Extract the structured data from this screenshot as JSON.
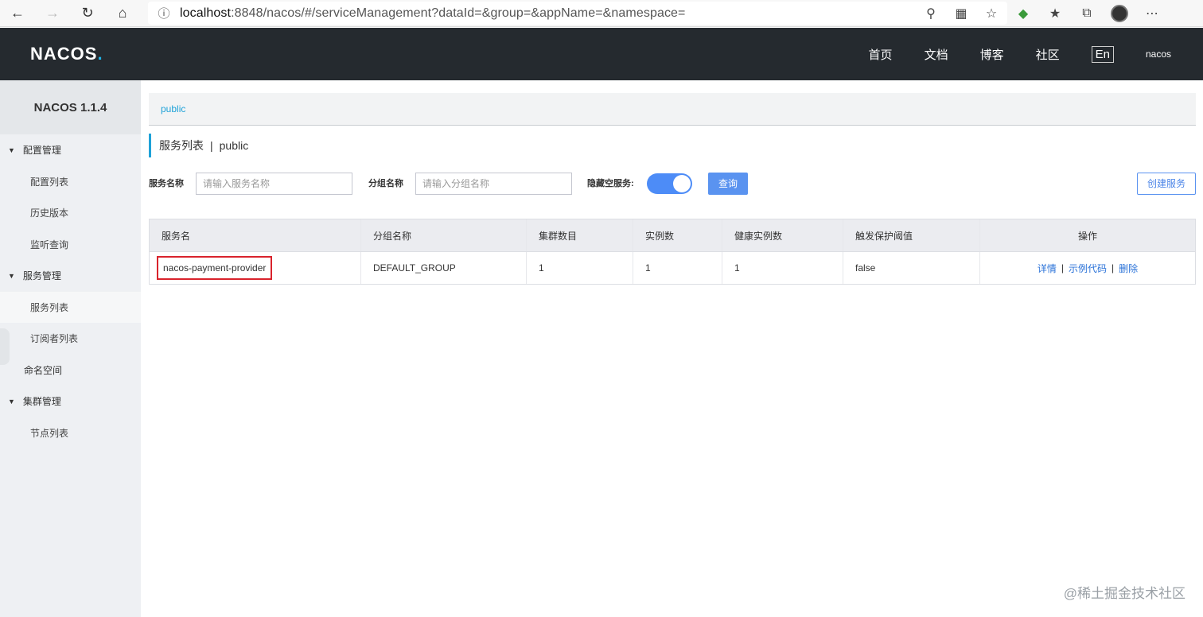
{
  "browser": {
    "url_host": "localhost",
    "url_rest": ":8848/nacos/#/serviceManagement?dataId=&group=&appName=&namespace="
  },
  "topnav": {
    "logo_text": "NACOS",
    "logo_dot": ".",
    "links": [
      "首页",
      "文档",
      "博客",
      "社区"
    ],
    "lang": "En",
    "user": "nacos"
  },
  "sidebar": {
    "title": "NACOS 1.1.4",
    "config_group": "配置管理",
    "config_items": [
      "配置列表",
      "历史版本",
      "监听查询"
    ],
    "service_group": "服务管理",
    "service_items": [
      "服务列表",
      "订阅者列表"
    ],
    "namespace": "命名空间",
    "cluster_group": "集群管理",
    "cluster_items": [
      "节点列表"
    ]
  },
  "breadcrumb": "public",
  "page_title": {
    "main": "服务列表",
    "sep": "|",
    "namespace": "public"
  },
  "filters": {
    "service_label": "服务名称",
    "service_placeholder": "请输入服务名称",
    "group_label": "分组名称",
    "group_placeholder": "请输入分组名称",
    "hide_empty_label": "隐藏空服务:",
    "hide_empty_on": true,
    "query_label": "查询",
    "create_label": "创建服务"
  },
  "table": {
    "headers": [
      "服务名",
      "分组名称",
      "集群数目",
      "实例数",
      "健康实例数",
      "触发保护阈值",
      "操作"
    ],
    "rows": [
      {
        "service": "nacos-payment-provider",
        "group": "DEFAULT_GROUP",
        "clusters": "1",
        "instances": "1",
        "healthy": "1",
        "threshold": "false",
        "ops": [
          "详情",
          "示例代码",
          "删除"
        ]
      }
    ]
  },
  "watermark": "@稀土掘金技术社区"
}
